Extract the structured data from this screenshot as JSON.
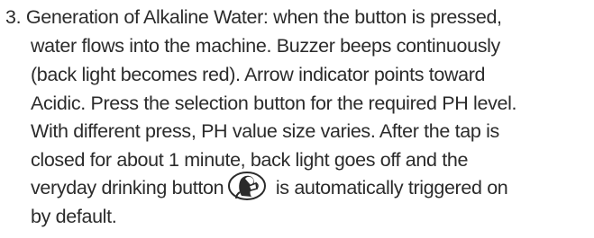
{
  "item": {
    "number": "3.",
    "lines": [
      "Generation of Alkaline Water: when the button is pressed,",
      "water flows into the machine. Buzzer beeps continuously",
      "(back light becomes red). Arrow indicator points toward",
      "Acidic. Press the selection button for the required PH level.",
      "With different press, PH value size varies. After the tap is",
      "closed for about 1 minute, back light goes off and the"
    ],
    "line7_before_icon": "veryday drinking button",
    "line7_after_icon": " is automatically triggered on",
    "line8": "by default.",
    "icon": "person-drinking-icon"
  }
}
